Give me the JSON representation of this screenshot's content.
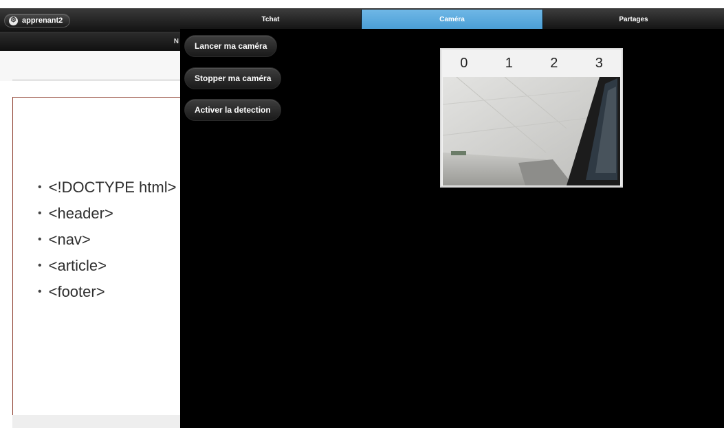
{
  "user": {
    "name": "apprenant2"
  },
  "nav": {
    "letter": "N"
  },
  "slide": {
    "items": [
      "<!DOCTYPE html>",
      "<header>",
      "<nav>",
      "<article>",
      "<footer>"
    ]
  },
  "panel": {
    "tabs": [
      {
        "label": "Tchat",
        "active": false
      },
      {
        "label": "Caméra",
        "active": true
      },
      {
        "label": "Partages",
        "active": false
      }
    ],
    "buttons": {
      "start": "Lancer ma caméra",
      "stop": "Stopper ma caméra",
      "detect": "Activer la detection"
    },
    "camera": {
      "columns": [
        "0",
        "1",
        "2",
        "3"
      ]
    }
  },
  "colors": {
    "active_tab": "#5aa9dd",
    "panel_bg": "#000000",
    "slide_border": "#8b3a2a"
  },
  "icons": {
    "settings": "gear-icon"
  }
}
